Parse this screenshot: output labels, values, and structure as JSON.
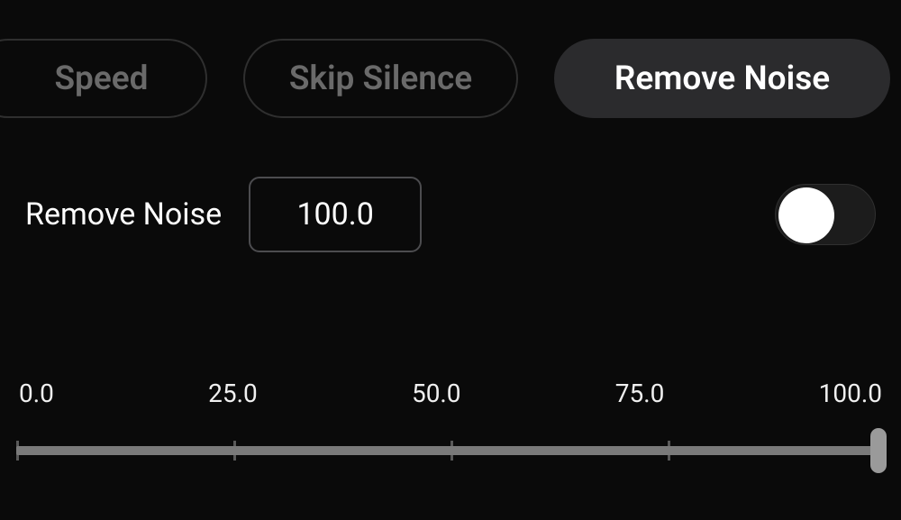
{
  "tabs": {
    "speed": "Speed",
    "skip_silence": "Skip Silence",
    "remove_noise": "Remove Noise",
    "active": "remove_noise"
  },
  "control": {
    "label": "Remove Noise",
    "value": "100.0",
    "toggle_on": false
  },
  "slider": {
    "ticks": [
      "0.0",
      "25.0",
      "50.0",
      "75.0",
      "100.0"
    ],
    "value": 100.0,
    "min": 0.0,
    "max": 100.0
  },
  "colors": {
    "background": "#0a0a0a",
    "tab_active_bg": "#2b2b2d",
    "tab_inactive_text": "#6a6a6a",
    "border": "#4c4c4f",
    "track": "#7a7a7a"
  }
}
